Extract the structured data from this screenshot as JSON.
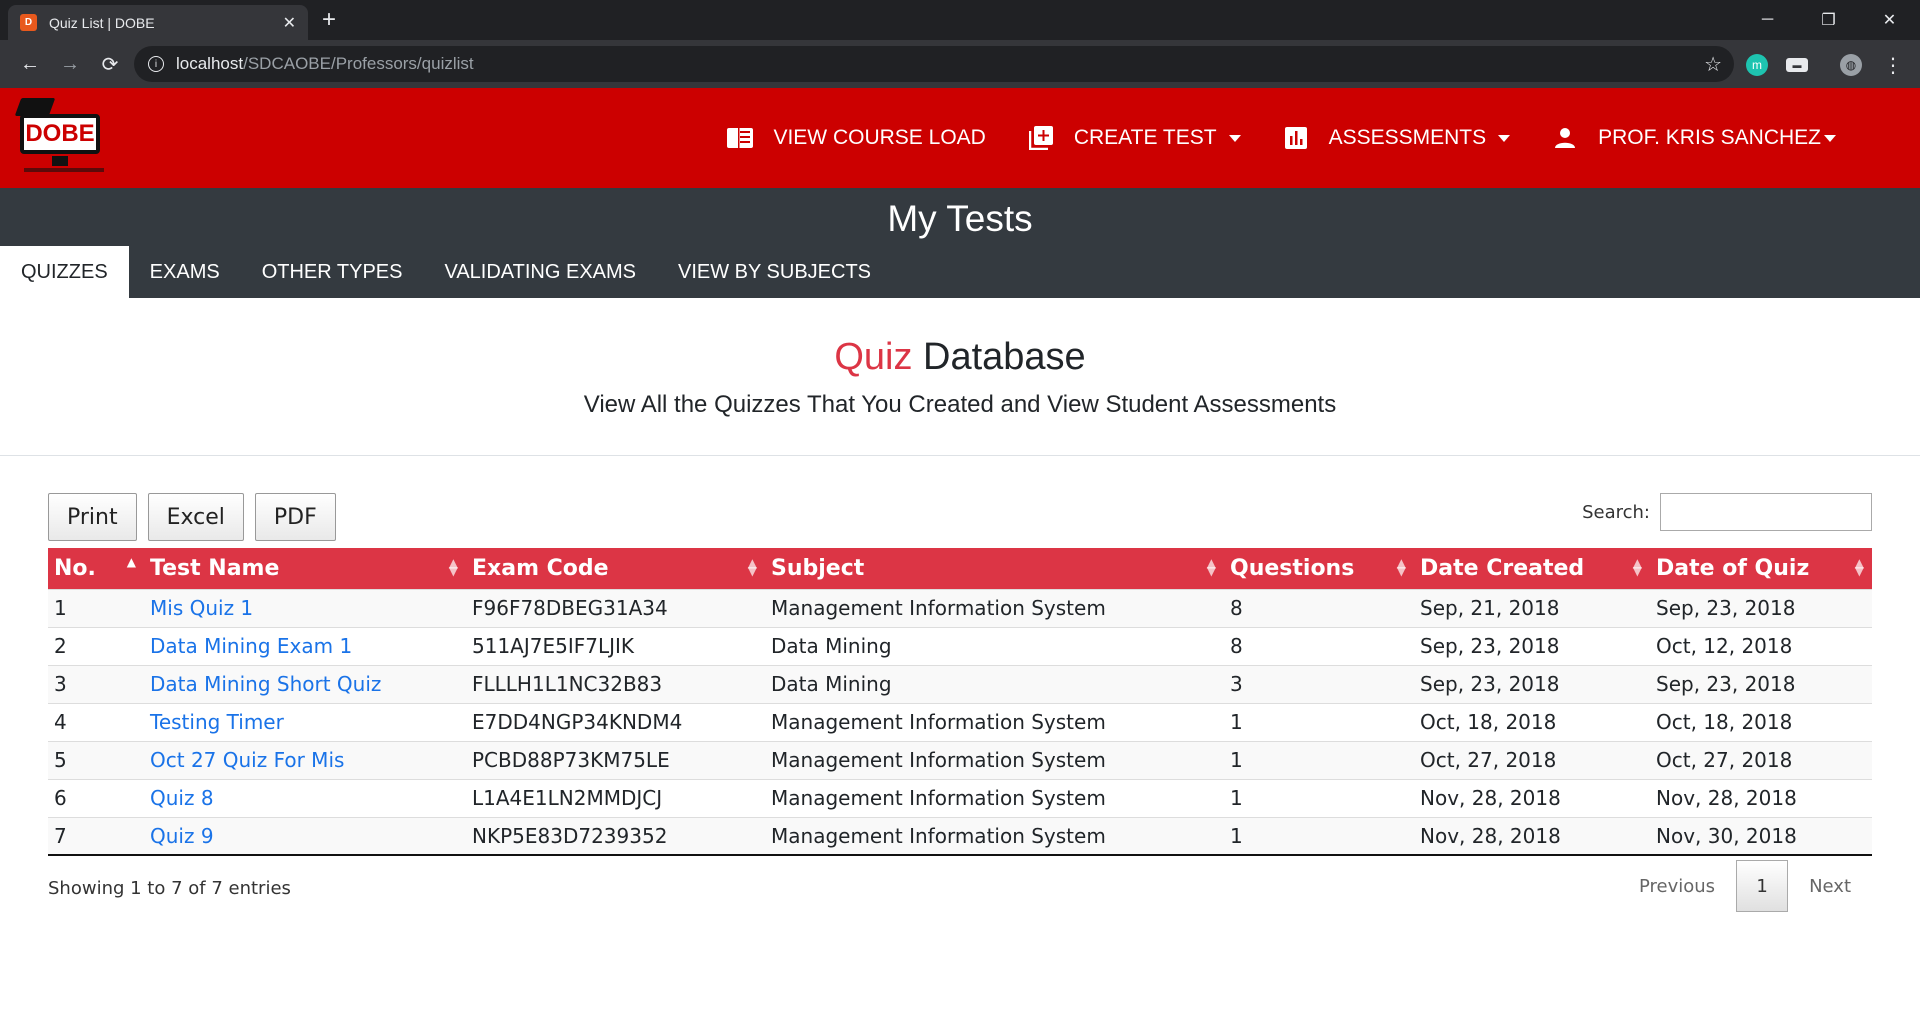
{
  "browser": {
    "tab_title": "Quiz List | DOBE",
    "favicon_letter": "D",
    "url_host": "localhost",
    "url_path": "/SDCAOBE/Professors/quizlist"
  },
  "header": {
    "logo_text": "DOBE",
    "nav": [
      {
        "label": "VIEW COURSE LOAD",
        "icon": "book-icon"
      },
      {
        "label": "CREATE TEST",
        "icon": "add-box-icon"
      },
      {
        "label": "ASSESSMENTS",
        "icon": "bar-chart-icon"
      },
      {
        "label": "PROF. KRIS SANCHEZ",
        "icon": "person-icon"
      }
    ]
  },
  "band": {
    "title": "My Tests",
    "tabs": [
      "QUIZZES",
      "EXAMS",
      "OTHER TYPES",
      "VALIDATING EXAMS",
      "VIEW BY SUBJECTS"
    ],
    "active_tab": "QUIZZES"
  },
  "page": {
    "title_red": "Quiz",
    "title_rest": " Database",
    "subtitle": "View All the Quizzes That You Created and View Student Assessments"
  },
  "table": {
    "buttons": [
      "Print",
      "Excel",
      "PDF"
    ],
    "search_label": "Search:",
    "search_value": "",
    "columns": [
      "No.",
      "Test Name",
      "Exam Code",
      "Subject",
      "Questions",
      "Date Created",
      "Date of Quiz"
    ],
    "rows": [
      [
        "1",
        "Mis Quiz 1",
        "F96F78DBEG31A34",
        "Management Information System",
        "8",
        "Sep, 21, 2018",
        "Sep, 23, 2018"
      ],
      [
        "2",
        "Data Mining Exam 1",
        "511AJ7E5IF7LJIK",
        "Data Mining",
        "8",
        "Sep, 23, 2018",
        "Oct, 12, 2018"
      ],
      [
        "3",
        "Data Mining Short Quiz",
        "FLLLH1L1NC32B83",
        "Data Mining",
        "3",
        "Sep, 23, 2018",
        "Sep, 23, 2018"
      ],
      [
        "4",
        "Testing Timer",
        "E7DD4NGP34KNDM4",
        "Management Information System",
        "1",
        "Oct, 18, 2018",
        "Oct, 18, 2018"
      ],
      [
        "5",
        "Oct 27 Quiz For Mis",
        "PCBD88P73KM75LE",
        "Management Information System",
        "1",
        "Oct, 27, 2018",
        "Oct, 27, 2018"
      ],
      [
        "6",
        "Quiz 8",
        "L1A4E1LN2MMDJCJ",
        "Management Information System",
        "1",
        "Nov, 28, 2018",
        "Nov, 28, 2018"
      ],
      [
        "7",
        "Quiz 9",
        "NKP5E83D7239352",
        "Management Information System",
        "1",
        "Nov, 28, 2018",
        "Nov, 30, 2018"
      ]
    ],
    "info": "Showing 1 to 7 of 7 entries",
    "pager": {
      "previous": "Previous",
      "current": "1",
      "next": "Next"
    }
  },
  "colors": {
    "brand_red": "#cc0000",
    "header_red": "#dc3545",
    "band": "#343a40",
    "link": "#1a73e8"
  }
}
